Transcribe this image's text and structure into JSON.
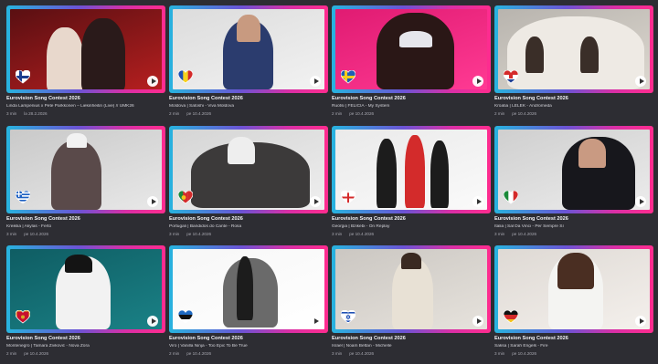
{
  "play_icon": "play-circle-icon",
  "cards": [
    {
      "title": "Eurovision Song Contest 2026",
      "subtitle": "Linda Lampenius x Pete Parkkonen – Liekinheitin (Live) // UMK26",
      "duration": "3 min",
      "date": "la 28.2.2026",
      "flag": "finland",
      "bg": [
        "#5a0f12",
        "#b51f1f"
      ]
    },
    {
      "title": "Eurovision Song Contest 2026",
      "subtitle": "Moldova | Satoshi - Viva Moldova",
      "duration": "2 min",
      "date": "pe 10.4.2026",
      "flag": "moldova",
      "bg": [
        "#dcdcdc",
        "#f2f2f2"
      ]
    },
    {
      "title": "Eurovision Song Contest 2026",
      "subtitle": "Ruotsi | FELICIA - My System",
      "duration": "2 min",
      "date": "pe 10.4.2026",
      "flag": "sweden",
      "bg": [
        "#e01b72",
        "#ff3a93"
      ]
    },
    {
      "title": "Eurovision Song Contest 2026",
      "subtitle": "Kroatia | LELEK - Andromeda",
      "duration": "2 min",
      "date": "pe 10.4.2026",
      "flag": "croatia",
      "bg": [
        "#b8b4ae",
        "#ddd8d0"
      ]
    },
    {
      "title": "Eurovision Song Contest 2026",
      "subtitle": "Kreikka | Akylas - Ferto",
      "duration": "3 min",
      "date": "pe 10.4.2026",
      "flag": "greece",
      "bg": [
        "#c9c9c9",
        "#e8e8e8"
      ]
    },
    {
      "title": "Eurovision Song Contest 2026",
      "subtitle": "Portugali | Bandidos do Cante - Rosa",
      "duration": "3 min",
      "date": "pe 10.4.2026",
      "flag": "portugal",
      "bg": [
        "#d5d5d5",
        "#efefef"
      ]
    },
    {
      "title": "Eurovision Song Contest 2026",
      "subtitle": "Georgia | Bzikebi - On Replay",
      "duration": "3 min",
      "date": "pe 10.4.2026",
      "flag": "georgia",
      "bg": [
        "#eaeaea",
        "#fafafa"
      ]
    },
    {
      "title": "Eurovision Song Contest 2026",
      "subtitle": "Italia | Sal Da Vinci - Per Sempre Sì",
      "duration": "3 min",
      "date": "pe 10.4.2026",
      "flag": "italy",
      "bg": [
        "#cfcfcf",
        "#ececec"
      ]
    },
    {
      "title": "Eurovision Song Contest 2026",
      "subtitle": "Montenegro | Tamara Živković - Nova Zora",
      "duration": "2 min",
      "date": "pe 10.4.2026",
      "flag": "montenegro",
      "bg": [
        "#0f5d63",
        "#1a8186"
      ]
    },
    {
      "title": "Eurovision Song Contest 2026",
      "subtitle": "Viro | Vanilla Ninja - Too Epic To Be True",
      "duration": "2 min",
      "date": "pe 10.4.2026",
      "flag": "estonia",
      "bg": [
        "#f7f7f7",
        "#ffffff"
      ]
    },
    {
      "title": "Eurovision Song Contest 2026",
      "subtitle": "Israel | Noam Bettan - Michelle",
      "duration": "3 min",
      "date": "pe 10.4.2026",
      "flag": "israel",
      "bg": [
        "#cbc7c2",
        "#e6e2dc"
      ]
    },
    {
      "title": "Eurovision Song Contest 2026",
      "subtitle": "Saksa | Sarah Engels - Fire",
      "duration": "3 min",
      "date": "pe 10.4.2026",
      "flag": "germany",
      "bg": [
        "#ded9d4",
        "#f4f0ec"
      ]
    }
  ]
}
